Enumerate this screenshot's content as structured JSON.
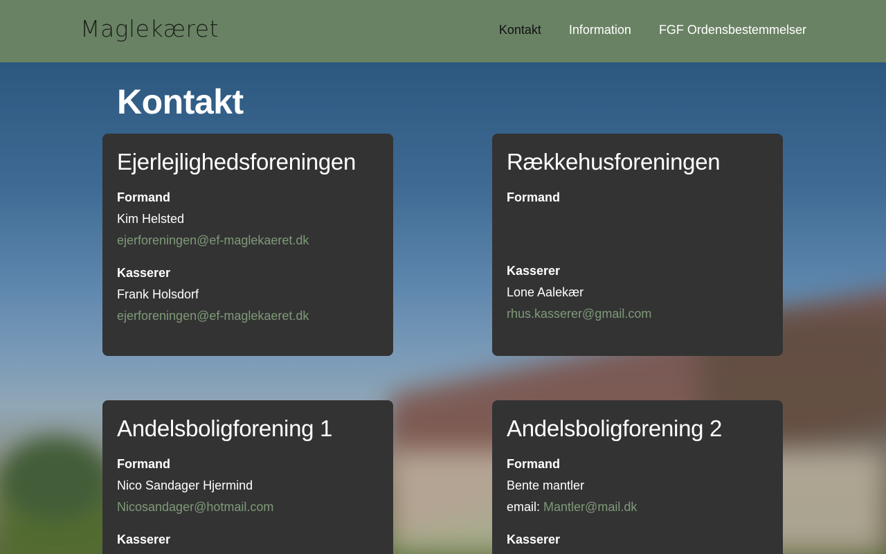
{
  "header": {
    "logo": "Maglekæret",
    "nav": [
      {
        "label": "Kontakt",
        "active": true
      },
      {
        "label": "Information",
        "active": false
      },
      {
        "label": "FGF Ordensbestemmelser",
        "active": false
      }
    ]
  },
  "page": {
    "title": "Kontakt"
  },
  "cards": [
    {
      "title": "Ejerlejlighedsforeningen",
      "formand_label": "Formand",
      "formand_name": "Kim Helsted",
      "formand_email": "ejerforeningen@ef-maglekaeret.dk",
      "kasserer_label": "Kasserer",
      "kasserer_name": "Frank Holsdorf",
      "kasserer_email": "ejerforeningen@ef-maglekaeret.dk"
    },
    {
      "title": "Rækkehusforeningen",
      "formand_label": "Formand",
      "kasserer_label": "Kasserer",
      "kasserer_name": "Lone Aalekær",
      "kasserer_email": "rhus.kasserer@gmail.com"
    },
    {
      "title": "Andelsboligforening 1",
      "formand_label": "Formand",
      "formand_name": "Nico Sandager Hjermind",
      "formand_email": "Nicosandager@hotmail.com",
      "kasserer_label": "Kasserer"
    },
    {
      "title": "Andelsboligforening 2",
      "formand_label": "Formand",
      "formand_name": "Bente mantler",
      "formand_email_prefix": "email:",
      "formand_email": "Mantler@mail.dk",
      "kasserer_label": "Kasserer"
    }
  ],
  "colors": {
    "header_bg": "#6a8264",
    "card_bg": "#333333",
    "link": "#7f9a78"
  }
}
